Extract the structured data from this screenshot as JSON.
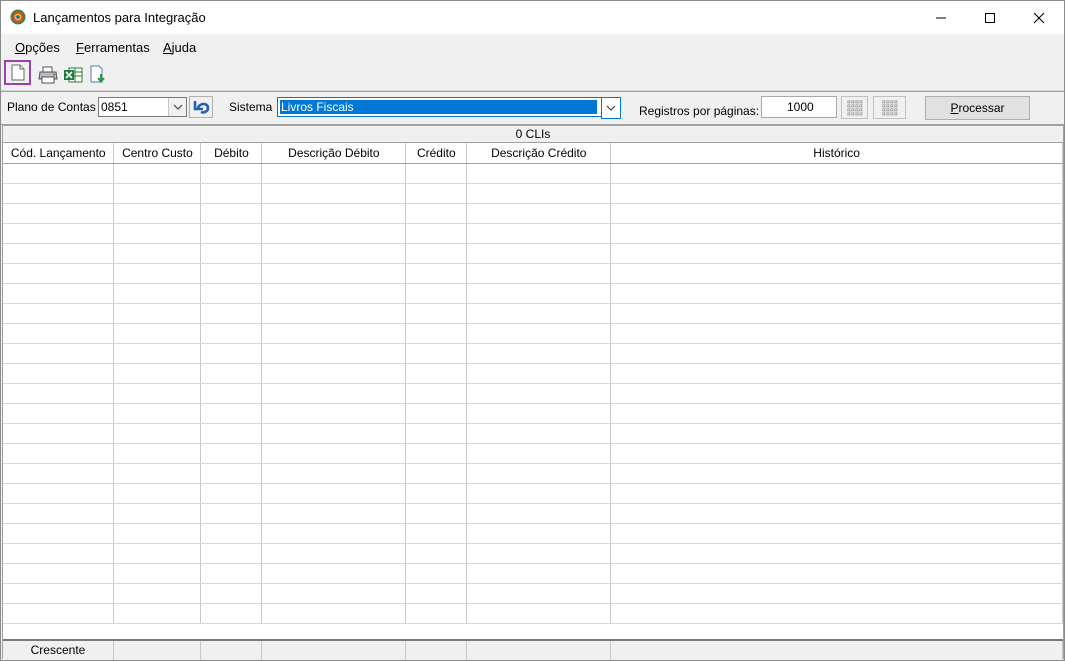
{
  "window": {
    "title": "Lançamentos para Integração"
  },
  "menu": [
    {
      "label": "Opções",
      "accel": "O",
      "rest": "pções"
    },
    {
      "label": "Ferramentas",
      "accel": "F",
      "rest": "erramentas"
    },
    {
      "label": "Ajuda",
      "accel": "A",
      "rest": "juda"
    }
  ],
  "toolbar": {
    "icons": [
      "new-document-icon",
      "printer-icon",
      "excel-export-icon",
      "import-icon"
    ]
  },
  "filters": {
    "plano_label": "Plano de Contas",
    "plano_value": "0851",
    "sistema_label": "Sistema",
    "sistema_value": "Livros Fiscais",
    "registros_label": "Registros por páginas:",
    "registros_value": "1000",
    "processar_label": "Processar",
    "processar_accel": "P",
    "processar_rest": "rocessar"
  },
  "grid": {
    "count_text": "0 CLIs",
    "columns": [
      "Cód. Lançamento",
      "Centro Custo",
      "Débito",
      "Descrição Débito",
      "Crédito",
      "Descrição Crédito",
      "Histórico"
    ],
    "footer_first": "Crescente"
  },
  "colors": {
    "accent": "#0078d7",
    "highlight_border": "#9c3fb0"
  }
}
